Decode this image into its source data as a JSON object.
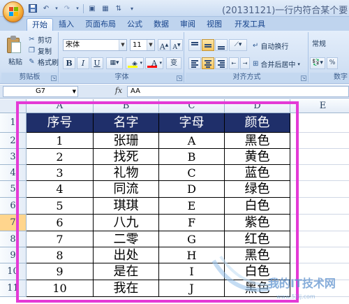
{
  "window": {
    "title": "(20131121)一行内符合某个要"
  },
  "tabs": [
    {
      "label": "开始",
      "active": true
    },
    {
      "label": "插入"
    },
    {
      "label": "页面布局"
    },
    {
      "label": "公式"
    },
    {
      "label": "数据"
    },
    {
      "label": "审阅"
    },
    {
      "label": "视图"
    },
    {
      "label": "开发工具"
    }
  ],
  "ribbon": {
    "clipboard": {
      "label": "剪贴板",
      "paste": "粘贴",
      "cut": "剪切",
      "copy": "复制",
      "format_painter": "格式刷"
    },
    "font": {
      "label": "字体",
      "font_name": "宋体",
      "font_size": "11",
      "bold": "B",
      "italic": "I",
      "underline": "U",
      "grow": "A",
      "shrink": "A",
      "font_color_letter": "A",
      "phonetic": "变"
    },
    "alignment": {
      "label": "对齐方式",
      "wrap_text": "自动换行",
      "merge_center": "合并后居中"
    },
    "number": {
      "label": "数字",
      "format": "常规"
    }
  },
  "formula_bar": {
    "name_box": "G7",
    "fx": "fx",
    "content": "AA"
  },
  "sheet": {
    "columns": [
      "A",
      "B",
      "C",
      "D",
      "E"
    ],
    "rows": [
      "1",
      "2",
      "3",
      "4",
      "5",
      "6",
      "7",
      "8",
      "9",
      "10",
      "11"
    ],
    "selected_row": "7",
    "header": [
      "序号",
      "名字",
      "字母",
      "颜色"
    ],
    "data": [
      [
        "1",
        "张珊",
        "A",
        "黑色"
      ],
      [
        "2",
        "找死",
        "B",
        "黄色"
      ],
      [
        "3",
        "礼物",
        "C",
        "蓝色"
      ],
      [
        "4",
        "同流",
        "D",
        "绿色"
      ],
      [
        "5",
        "琪琪",
        "E",
        "白色"
      ],
      [
        "6",
        "八九",
        "F",
        "紫色"
      ],
      [
        "7",
        "二零",
        "G",
        "红色"
      ],
      [
        "8",
        "出处",
        "H",
        "黑色"
      ],
      [
        "9",
        "是在",
        "I",
        "白色"
      ],
      [
        "10",
        "我在",
        "J",
        "黑色"
      ]
    ]
  },
  "colors": {
    "header_fill": "#1f2f6a",
    "highlight_border": "#e43ad6",
    "selected_row_header": "#ffd58d"
  },
  "watermark": {
    "text": "我的IT技术网",
    "sub": "www.52ij.com"
  }
}
